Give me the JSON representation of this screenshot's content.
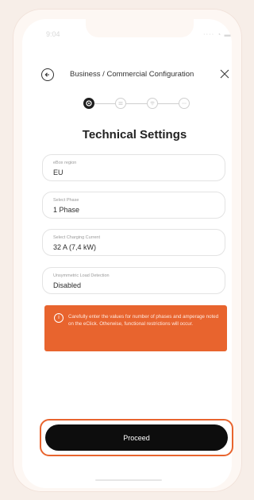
{
  "status_bar": {
    "time": "9:04",
    "icons": "‧‧‧‧ ◔ ▬"
  },
  "header": {
    "title": "Business / Commercial Configuration",
    "back_icon": "arrow-left-circle-icon",
    "close_icon": "close-icon"
  },
  "stepper": {
    "total_steps": 4,
    "active_step": 1,
    "icons": [
      "gear-icon",
      "list-icon",
      "wifi-icon",
      "ellipsis-icon"
    ]
  },
  "page": {
    "title": "Technical Settings"
  },
  "fields": [
    {
      "label": "eBox region",
      "value": "EU"
    },
    {
      "label": "Select Phase",
      "value": "1 Phase"
    },
    {
      "label": "Select Charging Current",
      "value": "32 A (7,4 kW)"
    },
    {
      "label": "Unsymmetric Load Detection",
      "value": "Disabled"
    }
  ],
  "alert": {
    "icon": "info-icon",
    "message": "Carefully enter the values for number of phases and amperage noted on the eClick. Otherwise, functional restrictions will occur."
  },
  "actions": {
    "proceed_label": "Proceed"
  },
  "colors": {
    "accent": "#e8642e",
    "button": "#0d0d0d",
    "background": "#f7eee8"
  }
}
